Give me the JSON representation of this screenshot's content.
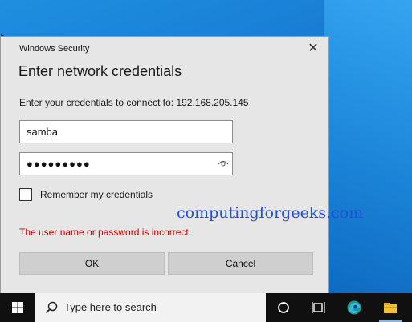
{
  "dialog": {
    "header": "Windows Security",
    "close_glyph": "✕",
    "title": "Enter network credentials",
    "prompt": "Enter your credentials to connect to: 192.168.205.145",
    "username_value": "samba",
    "password_value": "●●●●●●●●●",
    "remember_label": "Remember my credentials",
    "remember_checked": false,
    "error_message": "The user name or password is incorrect.",
    "ok_label": "OK",
    "cancel_label": "Cancel"
  },
  "watermark": "computingforgeeks.com",
  "taskbar": {
    "search_placeholder": "Type here to search"
  },
  "icons": [
    "windows-logo-icon",
    "search-icon",
    "cortana-icon",
    "task-view-icon",
    "edge-icon",
    "file-explorer-icon",
    "eye-icon",
    "mouse-cursor-icon"
  ],
  "colors": {
    "error": "#c00000",
    "dialog_bg": "#e6e6e6",
    "taskbar_bg": "#101010",
    "desktop_blue": "#1576cf",
    "watermark": "#1e4fd6"
  }
}
